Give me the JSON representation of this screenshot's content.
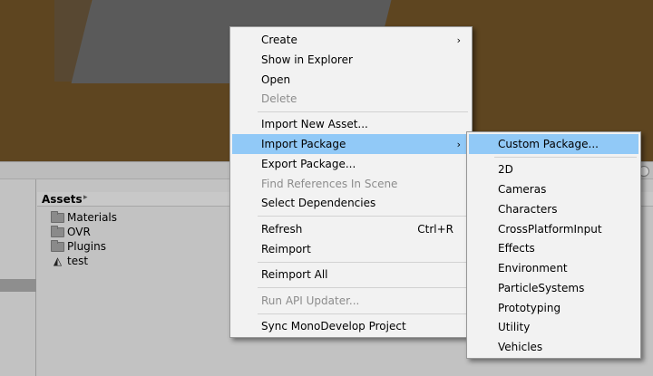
{
  "project": {
    "breadcrumb": "Assets",
    "breadcrumb_arrow": "▸",
    "items": [
      {
        "label": "Materials",
        "icon": "folder-icon"
      },
      {
        "label": "OVR",
        "icon": "folder-icon"
      },
      {
        "label": "Plugins",
        "icon": "folder-icon"
      },
      {
        "label": "test",
        "icon": "unity-scene-icon"
      }
    ]
  },
  "context_menu": {
    "items": [
      {
        "label": "Create",
        "submenu": true
      },
      {
        "label": "Show in Explorer"
      },
      {
        "label": "Open"
      },
      {
        "label": "Delete",
        "disabled": true
      },
      {
        "label": "Import New Asset..."
      },
      {
        "label": "Import Package",
        "submenu": true,
        "highlighted": true
      },
      {
        "label": "Export Package..."
      },
      {
        "label": "Find References In Scene",
        "disabled": true
      },
      {
        "label": "Select Dependencies"
      },
      {
        "label": "Refresh",
        "shortcut": "Ctrl+R"
      },
      {
        "label": "Reimport"
      },
      {
        "label": "Reimport All"
      },
      {
        "label": "Run API Updater...",
        "disabled": true
      },
      {
        "label": "Sync MonoDevelop Project"
      }
    ],
    "arrow": "›"
  },
  "submenu": {
    "items": [
      {
        "label": "Custom Package...",
        "highlighted": true
      },
      {
        "label": "2D"
      },
      {
        "label": "Cameras"
      },
      {
        "label": "Characters"
      },
      {
        "label": "CrossPlatformInput"
      },
      {
        "label": "Effects"
      },
      {
        "label": "Environment"
      },
      {
        "label": "ParticleSystems"
      },
      {
        "label": "Prototyping"
      },
      {
        "label": "Utility"
      },
      {
        "label": "Vehicles"
      }
    ]
  },
  "colors": {
    "highlight": "#91c9f7",
    "menu_bg": "#f2f2f2",
    "scene_bg": "#5e4520"
  }
}
